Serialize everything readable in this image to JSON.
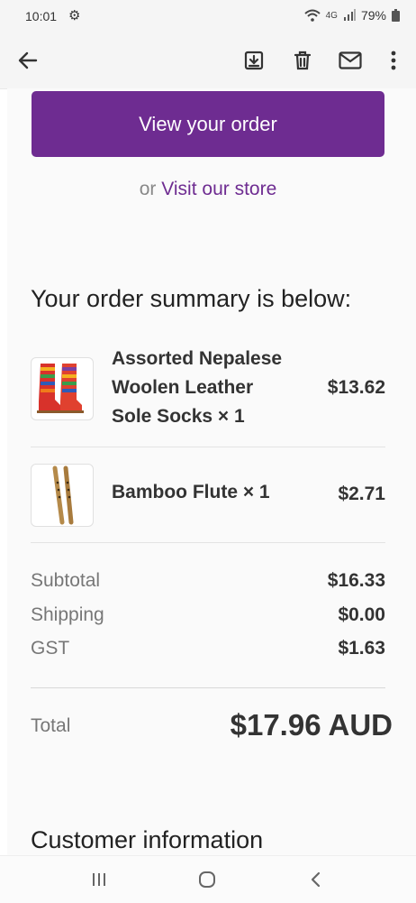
{
  "status": {
    "time": "10:01",
    "network": "4G",
    "battery": "79%"
  },
  "toolbar": {
    "icons": [
      "back-arrow-icon",
      "archive-icon",
      "delete-icon",
      "mail-icon",
      "more-vert-icon"
    ]
  },
  "email": {
    "view_order_label": "View your order",
    "or_text": "or",
    "visit_store_label": "Visit our store",
    "summary_title": "Your order summary is below:",
    "items": [
      {
        "name_lines": [
          "Assorted Nepalese",
          "Woolen Leather",
          "Sole Socks × 1"
        ],
        "price": "$13.62"
      },
      {
        "name_lines": [
          "Bamboo Flute × 1"
        ],
        "price": "$2.71"
      }
    ],
    "totals": {
      "subtotal_label": "Subtotal",
      "subtotal": "$16.33",
      "shipping_label": "Shipping",
      "shipping": "$0.00",
      "gst_label": "GST",
      "gst": "$1.63",
      "total_label": "Total",
      "total": "$17.96 AUD"
    },
    "customer_title": "Customer information"
  },
  "colors": {
    "accent": "#6e2c91"
  }
}
